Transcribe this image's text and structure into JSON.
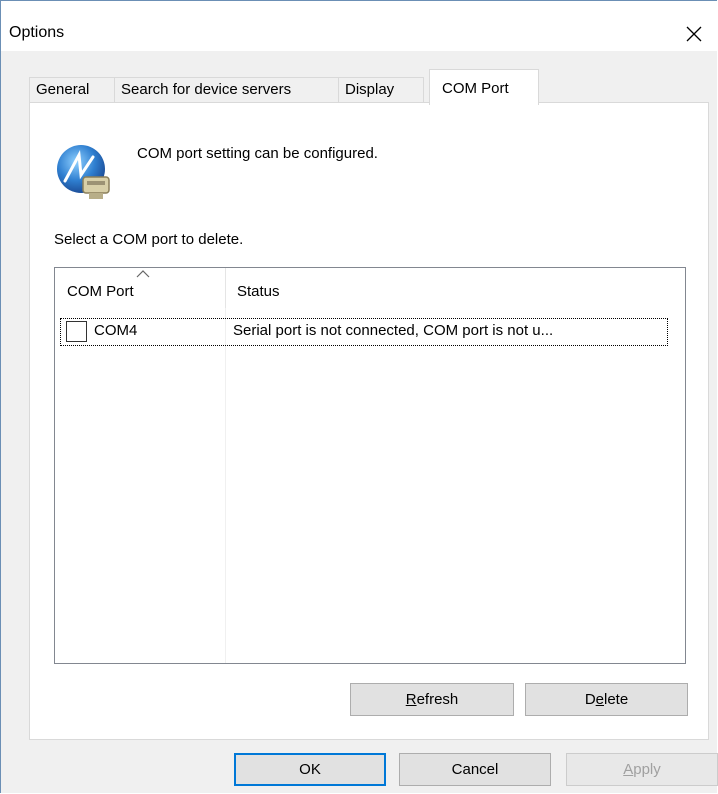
{
  "window": {
    "title": "Options"
  },
  "tabs": [
    {
      "label": "General"
    },
    {
      "label": "Search for device servers"
    },
    {
      "label": "Display"
    },
    {
      "label": "COM Port"
    }
  ],
  "com_port_tab": {
    "intro_text": "COM port setting can be configured.",
    "instruction": "Select a COM port to delete.",
    "list": {
      "columns": [
        "COM Port",
        "Status"
      ],
      "rows": [
        {
          "checked": false,
          "com_port": "COM4",
          "status": "Serial port is not connected, COM port is not u..."
        }
      ]
    },
    "buttons": {
      "refresh": {
        "accel": "R",
        "rest": "efresh"
      },
      "delete": {
        "pre": "D",
        "accel": "e",
        "rest": "lete"
      }
    }
  },
  "footer": {
    "ok": "OK",
    "cancel": "Cancel",
    "apply": {
      "accel": "A",
      "rest": "pply"
    }
  },
  "colors": {
    "accent": "#0078d7",
    "window_border": "#6b8fb5",
    "dialog_bg": "#f0f0f0"
  },
  "icons": [
    "close-icon",
    "com-port-app-icon",
    "sort-ascending-icon",
    "checkbox"
  ]
}
